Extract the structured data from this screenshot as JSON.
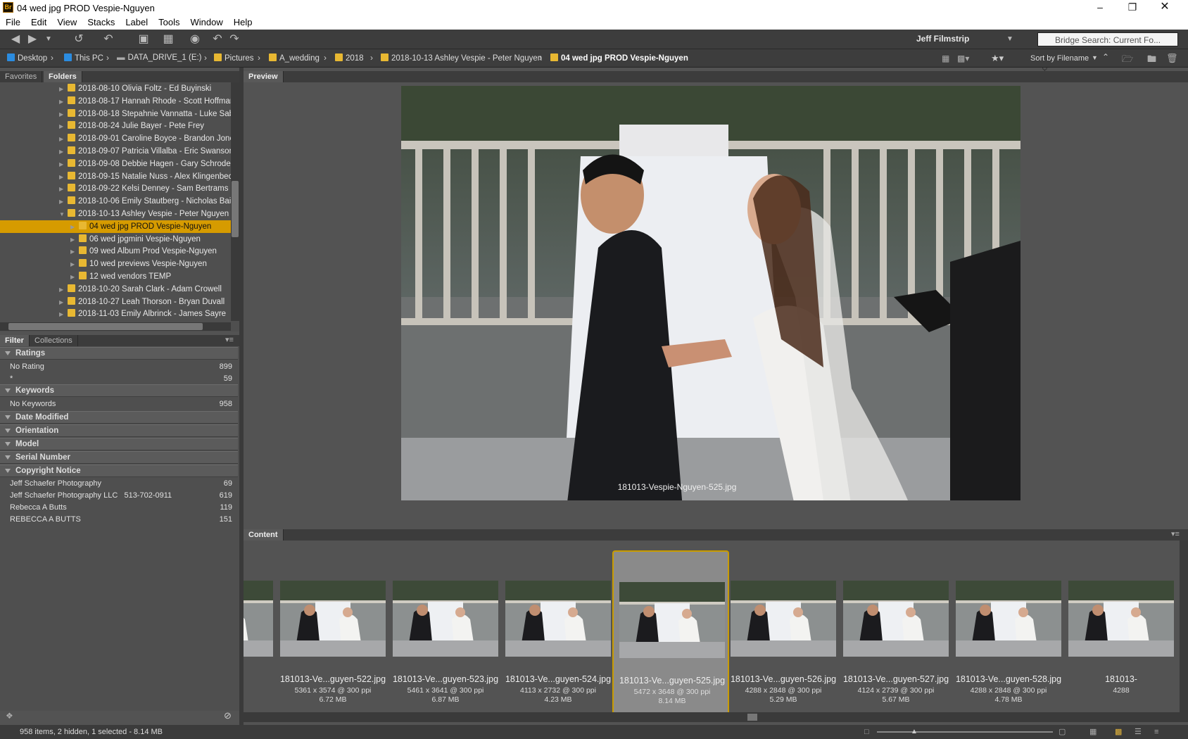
{
  "window": {
    "title": "04 wed jpg PROD Vespie-Nguyen",
    "app_icon": "Br"
  },
  "menu": [
    "File",
    "Edit",
    "View",
    "Stacks",
    "Label",
    "Tools",
    "Window",
    "Help"
  ],
  "toolbar": {
    "workspace": "Jeff Filmstrip",
    "search_placeholder": "Bridge Search: Current Fo..."
  },
  "path": {
    "items": [
      "Desktop",
      "This PC",
      "DATA_DRIVE_1 (E:)",
      "Pictures",
      "A_wedding",
      "2018",
      "2018-10-13 Ashley Vespie - Peter Nguyen",
      "04 wed jpg PROD Vespie-Nguyen"
    ],
    "sort": "Sort by Filename"
  },
  "left_tabs": {
    "favorites": "Favorites",
    "folders": "Folders"
  },
  "folders": [
    {
      "label": "2018-08-10 Olivia Foltz - Ed Buyinski",
      "indent": 1
    },
    {
      "label": "2018-08-17 Hannah Rhode - Scott Hoffmar",
      "indent": 1
    },
    {
      "label": "2018-08-18 Stepahnie Vannatta - Luke Sab",
      "indent": 1
    },
    {
      "label": "2018-08-24 Julie Bayer - Pete Frey",
      "indent": 1
    },
    {
      "label": "2018-09-01 Caroline Boyce - Brandon Jone",
      "indent": 1
    },
    {
      "label": "2018-09-07 Patricia Villalba - Eric Swanson",
      "indent": 1
    },
    {
      "label": "2018-09-08 Debbie Hagen - Gary Schroder",
      "indent": 1
    },
    {
      "label": "2018-09-15 Natalie Nuss - Alex Klingenbeck",
      "indent": 1
    },
    {
      "label": "2018-09-22 Kelsi Denney - Sam Bertrams",
      "indent": 1
    },
    {
      "label": "2018-10-06 Emily Stautberg - Nicholas Baile",
      "indent": 1
    },
    {
      "label": "2018-10-13 Ashley Vespie - Peter Nguyen",
      "indent": 1,
      "open": true
    },
    {
      "label": "04 wed jpg PROD Vespie-Nguyen",
      "indent": 2,
      "selected": true
    },
    {
      "label": "06 wed jpgmini Vespie-Nguyen",
      "indent": 2
    },
    {
      "label": "09 wed Album Prod Vespie-Nguyen",
      "indent": 2
    },
    {
      "label": "10 wed previews Vespie-Nguyen",
      "indent": 2
    },
    {
      "label": "12 wed vendors TEMP",
      "indent": 2
    },
    {
      "label": "2018-10-20 Sarah Clark - Adam Crowell",
      "indent": 1
    },
    {
      "label": "2018-10-27 Leah Thorson - Bryan Duvall",
      "indent": 1
    },
    {
      "label": "2018-11-03 Emily Albrinck - James Sayre",
      "indent": 1
    }
  ],
  "filter_tabs": {
    "filter": "Filter",
    "collections": "Collections"
  },
  "filter": {
    "ratings": {
      "title": "Ratings",
      "items": [
        {
          "label": "No Rating",
          "count": "899"
        },
        {
          "label": "*",
          "count": "59"
        }
      ]
    },
    "keywords": {
      "title": "Keywords",
      "items": [
        {
          "label": "No Keywords",
          "count": "958"
        }
      ]
    },
    "date_modified": "Date Modified",
    "orientation": "Orientation",
    "model": "Model",
    "serial": "Serial Number",
    "copyright": {
      "title": "Copyright Notice",
      "items": [
        {
          "label": "Jeff Schaefer Photography",
          "count": "69"
        },
        {
          "label": "Jeff Schaefer Photography LLC   513-702-0911",
          "count": "619"
        },
        {
          "label": "Rebecca A Butts",
          "count": "119"
        },
        {
          "label": "REBECCA A BUTTS",
          "count": "151"
        }
      ]
    }
  },
  "preview": {
    "tab": "Preview",
    "filename": "181013-Vespie-Nguyen-525.jpg"
  },
  "content": {
    "tab": "Content",
    "thumbs": [
      {
        "name": "-521.jpg",
        "dim": "0 ppi",
        "size": ""
      },
      {
        "name": "181013-Ve...guyen-522.jpg",
        "dim": "5361 x 3574 @ 300 ppi",
        "size": "6.72 MB"
      },
      {
        "name": "181013-Ve...guyen-523.jpg",
        "dim": "5461 x 3641 @ 300 ppi",
        "size": "6.87 MB"
      },
      {
        "name": "181013-Ve...guyen-524.jpg",
        "dim": "4113 x 2732 @ 300 ppi",
        "size": "4.23 MB"
      },
      {
        "name": "181013-Ve...guyen-525.jpg",
        "dim": "5472 x 3648 @ 300 ppi",
        "size": "8.14 MB",
        "selected": true
      },
      {
        "name": "181013-Ve...guyen-526.jpg",
        "dim": "4288 x 2848 @ 300 ppi",
        "size": "5.29 MB"
      },
      {
        "name": "181013-Ve...guyen-527.jpg",
        "dim": "4124 x 2739 @ 300 ppi",
        "size": "5.67 MB"
      },
      {
        "name": "181013-Ve...guyen-528.jpg",
        "dim": "4288 x 2848 @ 300 ppi",
        "size": "4.78 MB"
      },
      {
        "name": "181013-",
        "dim": "4288",
        "size": ""
      }
    ]
  },
  "status": {
    "text": "958 items, 2 hidden, 1 selected - 8.14 MB"
  },
  "colors": {
    "accent": "#d69b00",
    "panel": "#4f4f4f",
    "bg": "#535353"
  }
}
